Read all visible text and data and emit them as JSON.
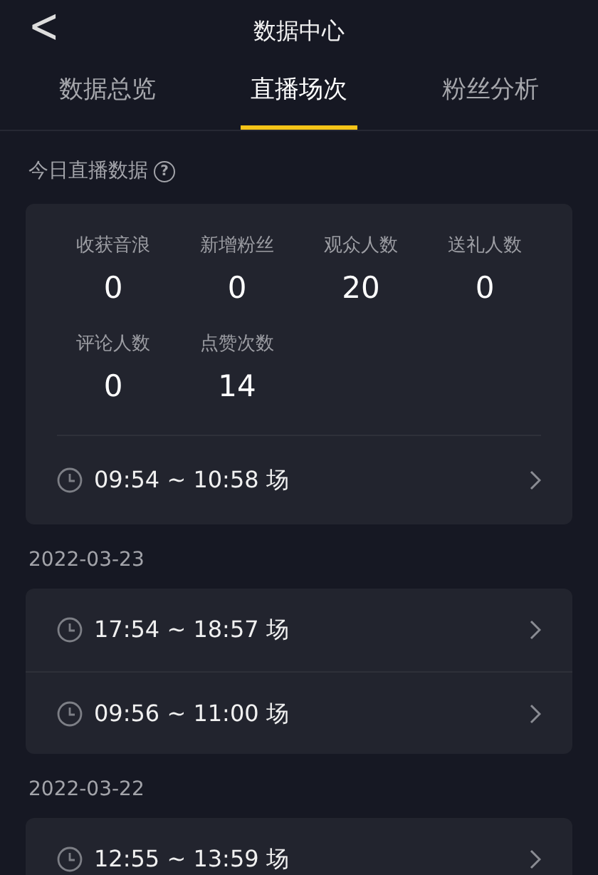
{
  "header": {
    "back": "<",
    "title": "数据中心"
  },
  "tabs": [
    {
      "label": "数据总览",
      "selected": false
    },
    {
      "label": "直播场次",
      "selected": true
    },
    {
      "label": "粉丝分析",
      "selected": false
    }
  ],
  "today": {
    "label": "今日直播数据",
    "help": "?",
    "stats": [
      {
        "label": "收获音浪",
        "value": "0"
      },
      {
        "label": "新增粉丝",
        "value": "0"
      },
      {
        "label": "观众人数",
        "value": "20"
      },
      {
        "label": "送礼人数",
        "value": "0"
      },
      {
        "label": "评论人数",
        "value": "0"
      },
      {
        "label": "点赞次数",
        "value": "14"
      }
    ],
    "sessions": [
      {
        "time": "09:54 ~ 10:58 场"
      }
    ]
  },
  "days": [
    {
      "date": "2022-03-23",
      "sessions": [
        {
          "time": "17:54 ~ 18:57 场"
        },
        {
          "time": "09:56 ~ 11:00 场"
        }
      ]
    },
    {
      "date": "2022-03-22",
      "sessions": [
        {
          "time": "12:55 ~ 13:59 场"
        }
      ]
    }
  ]
}
